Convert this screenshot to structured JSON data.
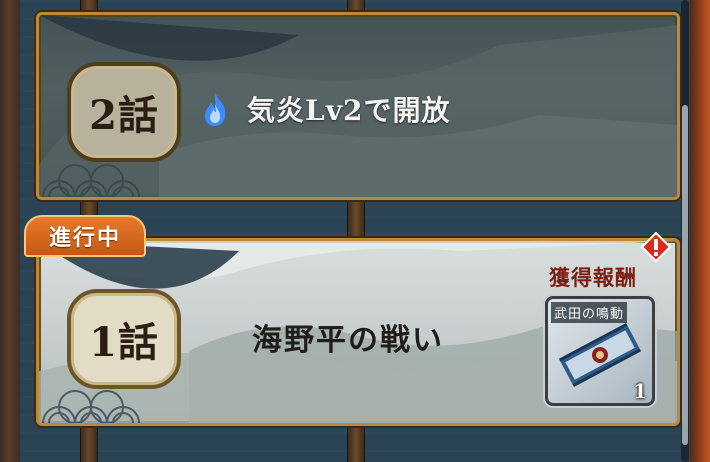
{
  "episodes": [
    {
      "number_label": "2話",
      "locked": true,
      "unlock_text": "気炎Lv2で開放",
      "icon": "blue-flame-icon"
    },
    {
      "number_label": "1話",
      "locked": false,
      "status": "進行中",
      "title": "海野平の戦い",
      "reward_label": "獲得報酬",
      "reward": {
        "name": "武田の鳴動",
        "count": "1",
        "icon": "scroll-item-icon"
      },
      "alert_icon": "exclamation-diamond-icon"
    }
  ],
  "colors": {
    "accent_orange": "#e67b2a",
    "frame_gold": "#b88a3d",
    "reward_red": "#7a1f14",
    "flame_blue": "#3a8cff"
  }
}
